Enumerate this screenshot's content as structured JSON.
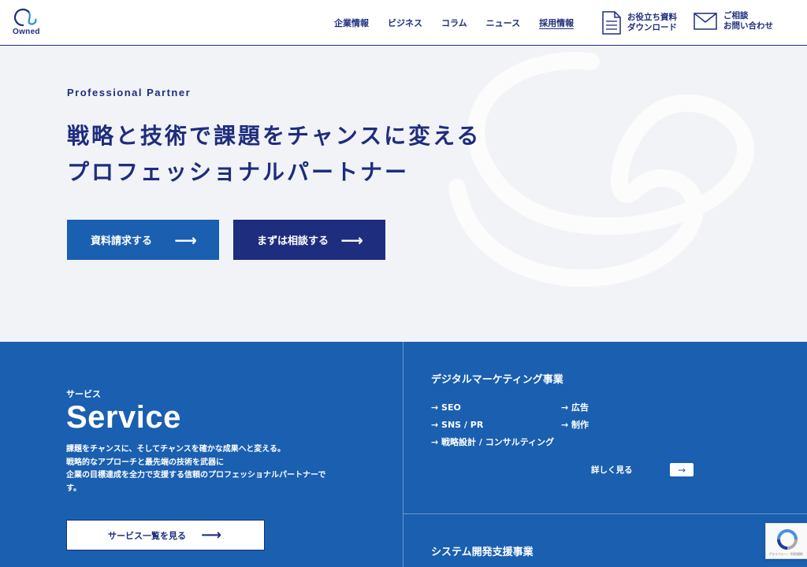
{
  "header": {
    "logo_text": "Owned",
    "nav": [
      "企業情報",
      "ビジネス",
      "コラム",
      "ニュース",
      "採用情報"
    ],
    "doc_button": [
      "お役立ち資料",
      "ダウンロード"
    ],
    "contact_button": [
      "ご相談",
      "お問い合わせ"
    ]
  },
  "hero": {
    "tagline": "Professional Partner",
    "headline_line1": "戦略と技術で課題をチャンスに変える",
    "headline_line2": "プロフェッショナルパートナー",
    "cta_request": "資料請求する",
    "cta_consult": "まずは相談する",
    "arrow": "⟶"
  },
  "services": {
    "kana": "サービス",
    "title": "Service",
    "description": [
      "課題をチャンスに、そしてチャンスを確かな成果へと変える。",
      "戦略的なアプローチと最先端の技術を武器に",
      "企業の目標達成を全力で支援する信頼のプロフェッショナルパートナーで",
      "す。"
    ],
    "list_button": "サービス一覧を見る",
    "digital_marketing": {
      "title": "デジタルマーケティング事業",
      "items_left": [
        "→ SEO",
        "→ SNS / PR",
        "→ 戦略設計 / コンサルティング"
      ],
      "items_right": [
        "→ 広告",
        "→ 制作"
      ],
      "more_label": "詳しく見る",
      "more_arrow": "→"
    },
    "system_dev": {
      "title": "システム開発支援事業"
    }
  },
  "recaptcha": {
    "text": "プライバシー - 利用規約"
  },
  "colors": {
    "navy": "#1e2d7d",
    "blue": "#1a5fb0",
    "hero_bg": "#f2f3f7"
  }
}
